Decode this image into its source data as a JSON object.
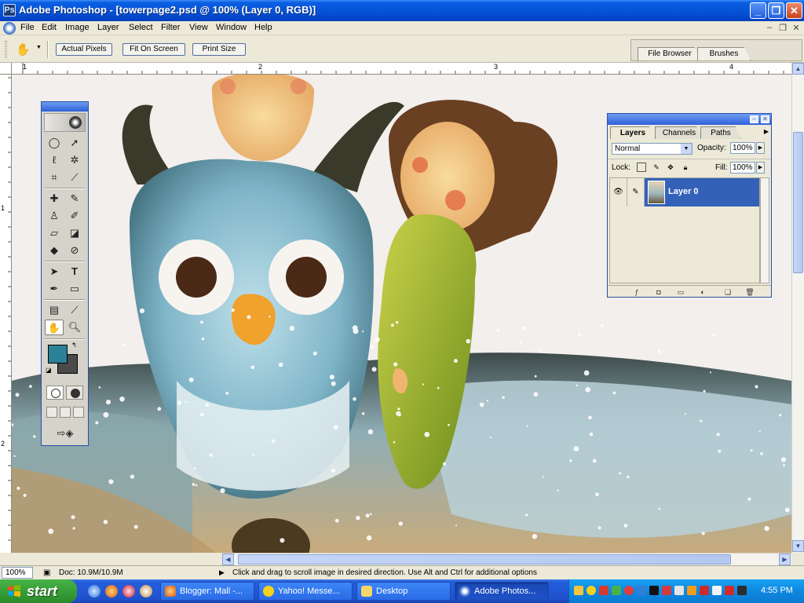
{
  "window": {
    "title": "Adobe Photoshop - [towerpage2.psd @ 100% (Layer 0, RGB)]"
  },
  "menu": {
    "items": [
      "File",
      "Edit",
      "Image",
      "Layer",
      "Select",
      "Filter",
      "View",
      "Window",
      "Help"
    ]
  },
  "options_bar": {
    "actual_pixels": "Actual Pixels",
    "fit_on_screen": "Fit On Screen",
    "print_size": "Print Size"
  },
  "palette_well": {
    "tabs": [
      "File Browser",
      "Brushes"
    ]
  },
  "rulers": {
    "horizontal": [
      "1",
      "2",
      "3",
      "4"
    ],
    "vertical": [
      "1",
      "2"
    ]
  },
  "tools": {
    "foreground_color": "#2b8296",
    "background_color": "#4a4a4a"
  },
  "layers_palette": {
    "tabs": [
      "Layers",
      "Channels",
      "Paths"
    ],
    "blend_mode": "Normal",
    "opacity_label": "Opacity:",
    "opacity_value": "100%",
    "lock_label": "Lock:",
    "fill_label": "Fill:",
    "fill_value": "100%",
    "layer_name": "Layer 0"
  },
  "status_bar": {
    "zoom": "100%",
    "doc_info": "Doc: 10.9M/10.9M",
    "message": "Click and drag to scroll image in desired direction.  Use Alt and Ctrl for additional options"
  },
  "taskbar": {
    "start_label": "start",
    "tasks": [
      {
        "label": "Blogger: Mall -..."
      },
      {
        "label": "Yahoo! Messe..."
      },
      {
        "label": "Desktop"
      },
      {
        "label": "Adobe Photos..."
      }
    ],
    "clock": "4:55 PM"
  }
}
